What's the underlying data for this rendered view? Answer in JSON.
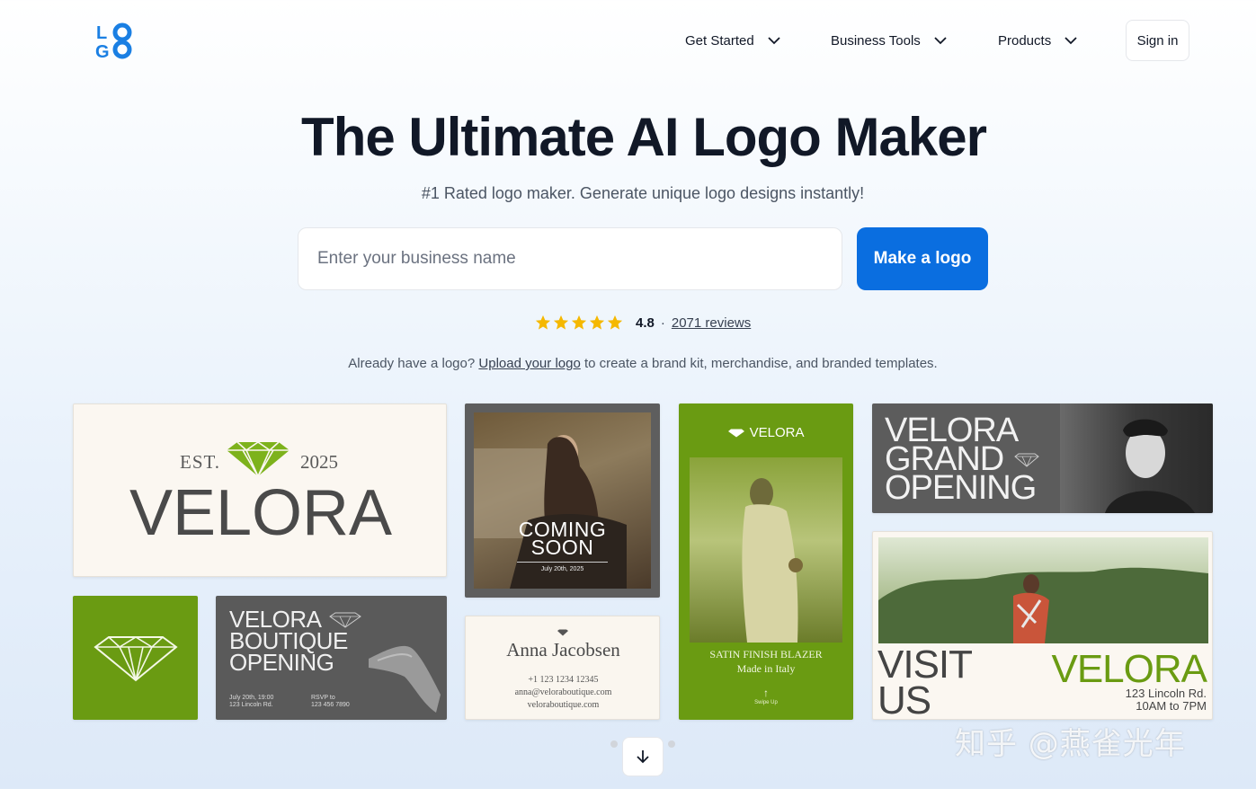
{
  "header": {
    "logo_text": "LOGO",
    "nav": [
      {
        "label": "Get Started"
      },
      {
        "label": "Business Tools"
      },
      {
        "label": "Products"
      }
    ],
    "signin_label": "Sign in"
  },
  "hero": {
    "title": "The Ultimate AI Logo Maker",
    "subtitle": "#1 Rated logo maker. Generate unique logo designs instantly!",
    "input_placeholder": "Enter your business name",
    "input_value": "",
    "cta_label": "Make a logo",
    "rating_value": "4.8",
    "rating_separator": "·",
    "reviews_label": "2071 reviews",
    "star_count": 5,
    "upload_prefix": "Already have a logo?",
    "upload_link": "Upload your logo",
    "upload_suffix": "to create a brand kit, merchandise, and branded templates."
  },
  "gallery": {
    "card1": {
      "est": "EST.",
      "year": "2025",
      "brand": "VELORA"
    },
    "card3": {
      "line1": "VELORA",
      "line2": "BOUTIQUE",
      "line3": "OPENING",
      "meta1a": "July 20th, 19:00",
      "meta1b": "123 Lincoln Rd.",
      "meta2a": "RSVP to",
      "meta2b": "123 456 7890"
    },
    "card4": {
      "line1": "COMING",
      "line2": "SOON",
      "date": "July 20th, 2025"
    },
    "card5": {
      "name": "Anna Jacobsen",
      "phone": "+1 123 1234 12345",
      "email": "anna@veloraboutique.com",
      "site": "veloraboutique.com"
    },
    "card6": {
      "brand": "VELORA",
      "title": "SATIN FINISH BLAZER",
      "sub": "Made in Italy",
      "arrow": "↑",
      "swipe": "Swipe Up"
    },
    "card7": {
      "line1": "VELORA",
      "line2": "GRAND",
      "line3": "OPENING"
    },
    "card8": {
      "visit1": "VISIT",
      "visit2": "US",
      "brand": "VELORA",
      "addr1": "123 Lincoln Rd.",
      "addr2": "10AM to 7PM"
    }
  },
  "watermark": "知乎 @燕雀光年",
  "colors": {
    "accent": "#0a6ee0",
    "brand_green": "#6a9b12",
    "star": "#f5b800"
  }
}
